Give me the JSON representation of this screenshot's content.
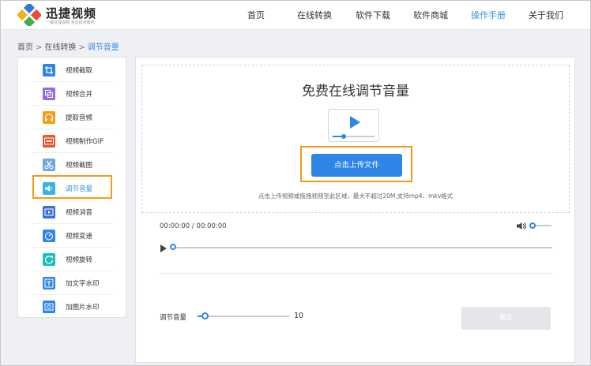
{
  "header": {
    "brand": "迅捷视频",
    "slogan": "一键处理视频 专业技术服务",
    "nav": [
      {
        "label": "首页"
      },
      {
        "label": "在线转换"
      },
      {
        "label": "软件下载"
      },
      {
        "label": "软件商城"
      },
      {
        "label": "操作手册"
      },
      {
        "label": "关于我们"
      }
    ],
    "active_nav": "操作手册"
  },
  "breadcrumb": {
    "items": [
      "首页",
      "在线转换",
      "调节音量"
    ],
    "separator": ">"
  },
  "sidebar": {
    "items": [
      {
        "label": "视频截取",
        "icon": "crop-icon",
        "color": "#2f86e6"
      },
      {
        "label": "视频合并",
        "icon": "merge-icon",
        "color": "#8e6ee0"
      },
      {
        "label": "提取音频",
        "icon": "headphones-icon",
        "color": "#f39c12"
      },
      {
        "label": "视频制作GIF",
        "icon": "gif-icon",
        "color": "#e8542c"
      },
      {
        "label": "视频截图",
        "icon": "scissors-icon",
        "color": "#6fa8dc"
      },
      {
        "label": "调节音量",
        "icon": "volume-icon",
        "color": "#36b3e8"
      },
      {
        "label": "视频消音",
        "icon": "mute-icon",
        "color": "#3a6fd8"
      },
      {
        "label": "视频变速",
        "icon": "speed-icon",
        "color": "#2f86e6"
      },
      {
        "label": "视频旋转",
        "icon": "rotate-icon",
        "color": "#18c0b8"
      },
      {
        "label": "加文字水印",
        "icon": "text-watermark-icon",
        "color": "#2f86e6"
      },
      {
        "label": "加图片水印",
        "icon": "image-watermark-icon",
        "color": "#2f86e6"
      }
    ],
    "active": "调节音量"
  },
  "main": {
    "title": "免费在线调节音量",
    "upload_label": "点击上传文件",
    "hint": "点击上传视频或拖拽视频至此区域，最大不超过20M,支持mp4、mkv格式",
    "player": {
      "current_time": "00:00:00",
      "separator": "/",
      "total_time": "00:00:00",
      "progress": 0
    },
    "volume_adjust": {
      "label": "调节音量",
      "value": "10",
      "level": 0.1
    },
    "confirm_label": "确定"
  },
  "colors": {
    "accent": "#2f86e6",
    "highlight": "#f39c12",
    "disabled": "#e4e6e9"
  }
}
